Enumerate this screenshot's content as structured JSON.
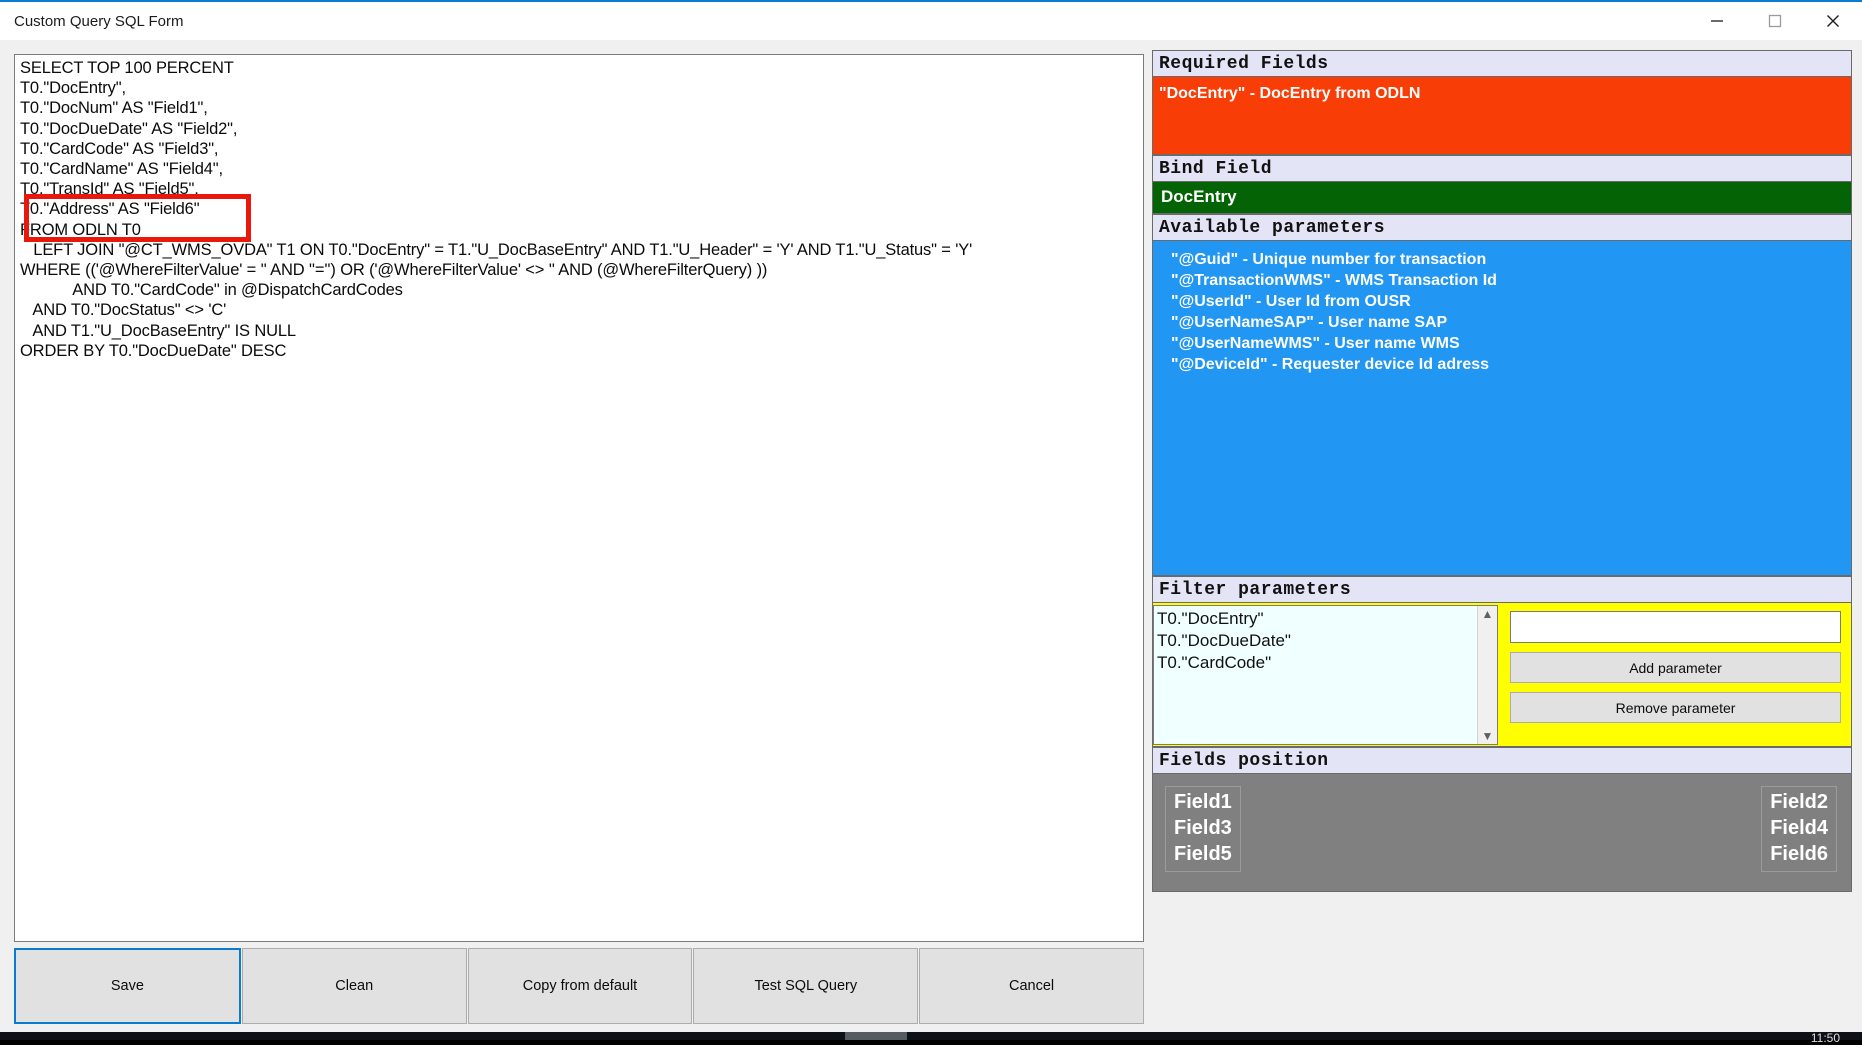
{
  "window": {
    "title": "Custom Query SQL Form",
    "controls": {
      "minimize": "minimize-icon",
      "maximize": "maximize-icon",
      "close": "close-icon"
    }
  },
  "sql_editor": {
    "name": "sql-query-textarea",
    "value": "SELECT TOP 100 PERCENT\nT0.\"DocEntry\",\nT0.\"DocNum\" AS \"Field1\",\nT0.\"DocDueDate\" AS \"Field2\",\nT0.\"CardCode\" AS \"Field3\",\nT0.\"CardName\" AS \"Field4\",\nT0.\"TransId\" AS \"Field5\",\nT0.\"Address\" AS \"Field6\"\nFROM ODLN T0\n   LEFT JOIN \"@CT_WMS_OVDA\" T1 ON T0.\"DocEntry\" = T1.\"U_DocBaseEntry\" AND T1.\"U_Header\" = 'Y' AND T1.\"U_Status\" = 'Y'\nWHERE (('@WhereFilterValue' = '' AND ''='') OR ('@WhereFilterValue' <> '' AND (@WhereFilterQuery) ))\n            AND T0.\"CardCode\" in @DispatchCardCodes\n   AND T0.\"DocStatus\" <> 'C'\n   AND T1.\"U_DocBaseEntry\" IS NULL\nORDER BY T0.\"DocDueDate\" DESC"
  },
  "annotation": {
    "name": "red-highlight-rectangle",
    "color": "#e8180d",
    "highlighted_lines": [
      "T0.\"TransId\" AS \"Field5\",",
      "T0.\"Address\" AS \"Field6\""
    ]
  },
  "buttons": {
    "save": "Save",
    "clean": "Clean",
    "copy_from_default": "Copy from default",
    "test_sql_query": "Test SQL Query",
    "cancel": "Cancel"
  },
  "required_fields": {
    "header": "Required Fields",
    "background": "#f93d06",
    "items": [
      "\"DocEntry\" - DocEntry from ODLN"
    ]
  },
  "bind_field": {
    "header": "Bind Field",
    "background": "#046305",
    "value": "DocEntry"
  },
  "available_parameters": {
    "header": "Available parameters",
    "background": "#2196f3",
    "items": [
      "\"@Guid\" - Unique number for transaction",
      "\"@TransactionWMS\" - WMS Transaction Id",
      "\"@UserId\" - User Id from OUSR",
      "\"@UserNameSAP\" - User name SAP",
      "\"@UserNameWMS\" - User name WMS",
      "\"@DeviceId\" - Requester device Id adress"
    ]
  },
  "filter_parameters": {
    "header": "Filter parameters",
    "background": "#ffff00",
    "items": [
      "T0.\"DocEntry\"",
      "T0.\"DocDueDate\"",
      "T0.\"CardCode\""
    ],
    "input_value": "",
    "input_placeholder": "",
    "add_button": "Add parameter",
    "remove_button": "Remove parameter",
    "scroll_up_icon": "chevron-up-icon",
    "scroll_down_icon": "chevron-down-icon"
  },
  "fields_position": {
    "header": "Fields position",
    "background": "#808080",
    "left_column": [
      "Field1",
      "Field3",
      "Field5"
    ],
    "right_column": [
      "Field2",
      "Field4",
      "Field6"
    ]
  },
  "taskbar": {
    "clock": "11:50"
  }
}
